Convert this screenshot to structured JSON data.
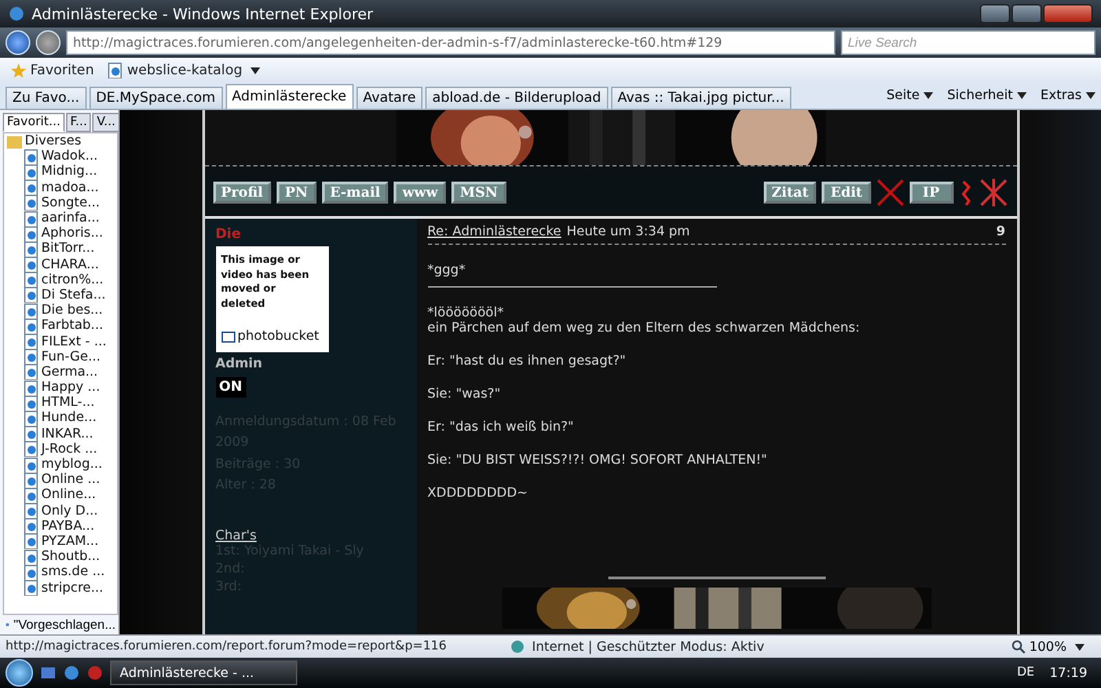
{
  "window": {
    "title": "Adminlästerecke - Windows Internet Explorer"
  },
  "address_bar": {
    "url": "http://magictraces.forumieren.com/angelegenheiten-der-admin-s-f7/adminlasterecke-t60.htm#129",
    "search_placeholder": "Live Search"
  },
  "favorites_bar": {
    "favorites": "Favoriten",
    "items": [
      "webslice-katalog"
    ]
  },
  "tabs_row": {
    "add_favorites": "Zu Favo...",
    "tabs": [
      {
        "label": "DE.MySpace.com",
        "selected": false
      },
      {
        "label": "Adminlästerecke",
        "selected": true
      },
      {
        "label": "Avatare",
        "selected": false
      },
      {
        "label": "abload.de - Bilderupload",
        "selected": false
      },
      {
        "label": "Avas :: Takai.jpg pictur...",
        "selected": false
      }
    ],
    "commands": [
      "Seite",
      "Sicherheit",
      "Extras"
    ]
  },
  "sidebar": {
    "tabs": [
      {
        "label": "Favorit...",
        "selected": true
      },
      {
        "label": "F...",
        "selected": false
      },
      {
        "label": "V...",
        "selected": false
      }
    ],
    "folder": "Diverses",
    "items": [
      "Wadok...",
      "Midnig...",
      "madoa...",
      "Songte...",
      "aarinfa...",
      "Aphoris...",
      "BitTorr...",
      "CHARA...",
      "citron%...",
      "Di Stefa...",
      "Die bes...",
      "Farbtab...",
      "FILExt - ...",
      "Fun-Ge...",
      "Germa...",
      "Happy ...",
      "HTML-...",
      "Hunde...",
      "INKAR...",
      "J-Rock ...",
      "myblog...",
      "Online ...",
      "Online...",
      "Only D...",
      "PAYBA...",
      "PYZAM...",
      "Shoutb...",
      "sms.de ...",
      "stripcre..."
    ],
    "suggested": "\"Vorgeschlagen..."
  },
  "post": {
    "profile_buttons": [
      "Profil",
      "PN",
      "E-mail",
      "www",
      "MSN"
    ],
    "action_buttons": [
      "Zitat",
      "Edit",
      "IP"
    ],
    "author": "Die",
    "broken_image": {
      "message": "This image or video has been moved or deleted",
      "brand": "photobucket"
    },
    "rank": "Admin",
    "online": "ON",
    "stats": [
      "Anmeldungsdatum : 08 Feb 2009",
      "Beiträge : 30",
      "Alter : 28"
    ],
    "chars_title": "Char's",
    "chars": [
      "1st: Yoiyami Takai - Sly",
      "2nd:",
      "3rd:"
    ],
    "subject": "Re: Adminlästerecke",
    "time": "Heute um 3:34 pm",
    "number": "9",
    "body": [
      {
        "kind": "text",
        "text": "*ggg*"
      },
      {
        "kind": "rule"
      },
      {
        "kind": "text",
        "text": "*löööööööl*"
      },
      {
        "kind": "line",
        "text": "ein Pärchen auf dem weg zu den Eltern des schwarzen Mädchens:"
      },
      {
        "kind": "text",
        "text": "Er: \"hast du es ihnen gesagt?\""
      },
      {
        "kind": "text",
        "text": "Sie: \"was?\""
      },
      {
        "kind": "text",
        "text": "Er: \"das ich weiß bin?\""
      },
      {
        "kind": "text",
        "text": "Sie: \"DU BIST WEISS?!?! OMG! SOFORT ANHALTEN!\""
      },
      {
        "kind": "text",
        "text": "XDDDDDDDD~"
      }
    ]
  },
  "status_bar": {
    "url": "http://magictraces.forumieren.com/report.forum?mode=report&p=116",
    "zone": "Internet | Geschützter Modus: Aktiv",
    "zoom": "100%"
  },
  "taskbar": {
    "tasks": [
      "Adminlästerecke - ..."
    ],
    "language": "DE",
    "clock": "17:19"
  }
}
